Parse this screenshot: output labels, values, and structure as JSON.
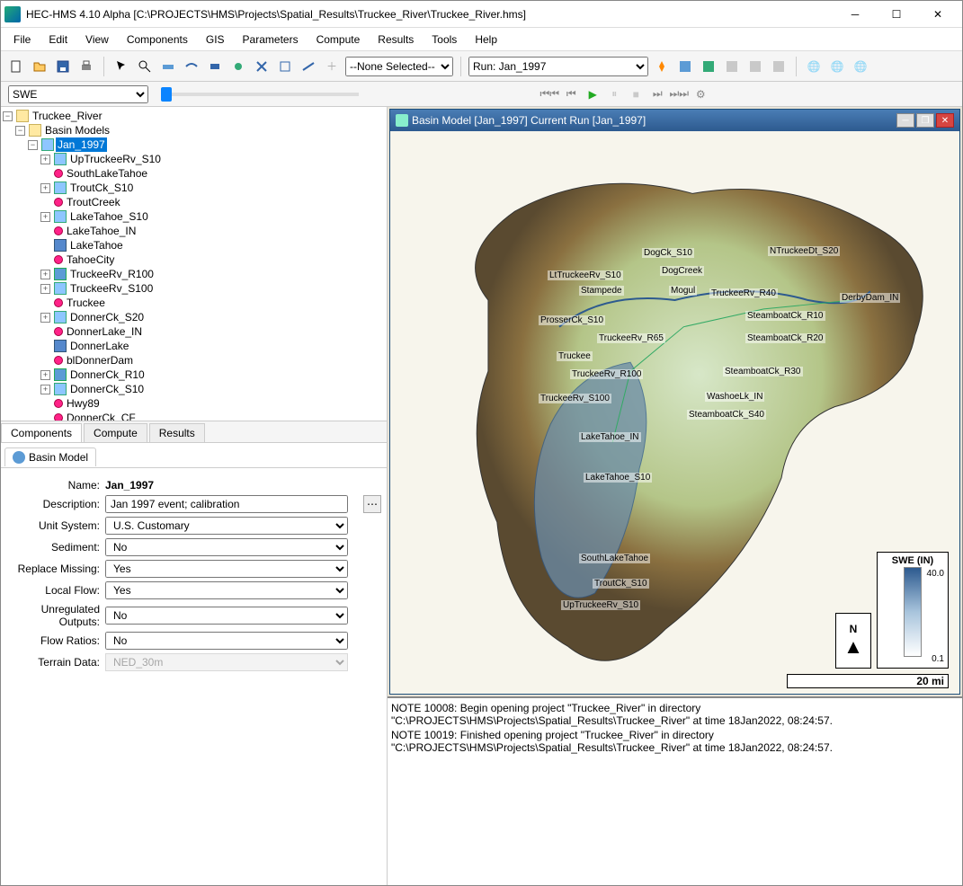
{
  "window": {
    "title": "HEC-HMS 4.10 Alpha [C:\\PROJECTS\\HMS\\Projects\\Spatial_Results\\Truckee_River\\Truckee_River.hms]"
  },
  "menu": [
    "File",
    "Edit",
    "View",
    "Components",
    "GIS",
    "Parameters",
    "Compute",
    "Results",
    "Tools",
    "Help"
  ],
  "toolbar": {
    "none_selected": "--None Selected--",
    "run_label": "Run: Jan_1997"
  },
  "secondbar": {
    "dropdown": "SWE"
  },
  "tree": {
    "root": "Truckee_River",
    "basinmodels": "Basin Models",
    "selected": "Jan_1997",
    "items": [
      "UpTruckeeRv_S10",
      "SouthLakeTahoe",
      "TroutCk_S10",
      "TroutCreek",
      "LakeTahoe_S10",
      "LakeTahoe_IN",
      "LakeTahoe",
      "TahoeCity",
      "TruckeeRv_R100",
      "TruckeeRv_S100",
      "Truckee",
      "DonnerCk_S20",
      "DonnerLake_IN",
      "DonnerLake",
      "blDonnerDam",
      "DonnerCk_R10",
      "DonnerCk_S10",
      "Hwy89",
      "DonnerCk_CF"
    ]
  },
  "tabs": {
    "components": "Components",
    "compute": "Compute",
    "results": "Results"
  },
  "proptab": "Basin Model",
  "props": {
    "name_label": "Name:",
    "name_value": "Jan_1997",
    "desc_label": "Description:",
    "desc_value": "Jan 1997 event; calibration",
    "unit_label": "Unit System:",
    "unit_value": "U.S. Customary",
    "sediment_label": "Sediment:",
    "sediment_value": "No",
    "replace_label": "Replace Missing:",
    "replace_value": "Yes",
    "local_label": "Local Flow:",
    "local_value": "Yes",
    "unreg_label": "Unregulated Outputs:",
    "unreg_value": "No",
    "flow_label": "Flow Ratios:",
    "flow_value": "No",
    "terrain_label": "Terrain Data:",
    "terrain_value": "NED_30m"
  },
  "subwindow": {
    "title": "Basin Model [Jan_1997] Current Run [Jan_1997]"
  },
  "map": {
    "labels": {
      "dogck": "DogCk_S10",
      "dogcreek": "DogCreek",
      "ntruckee": "NTruckeeDt_S20",
      "lttruckee": "LtTruckeeRv_S10",
      "stampede": "Stampede",
      "mogul": "Mogul",
      "truckeerv40": "TruckeeRv_R40",
      "derby": "DerbyDam_IN",
      "prosser": "ProsserCk_S10",
      "truckeerv65": "TruckeeRv_R65",
      "steamr10": "SteamboatCk_R10",
      "steamr20": "SteamboatCk_R20",
      "truckee": "Truckee",
      "truckeerv100": "TruckeeRv_R100",
      "steamr30": "SteamboatCk_R30",
      "truckeervs100": "TruckeeRv_S100",
      "washoe": "WashoeLk_IN",
      "steams40": "SteamboatCk_S40",
      "laketahoein": "LakeTahoe_IN",
      "laketahoes10": "LakeTahoe_S10",
      "southlake": "SouthLakeTahoe",
      "troutck": "TroutCk_S10",
      "uptruckee": "UpTruckeeRv_S10"
    },
    "compass": "N",
    "legend_title": "SWE (IN)",
    "legend_max": "40.0",
    "legend_min": "0.1",
    "scale": "20 mi"
  },
  "log": {
    "line1": "NOTE 10008:  Begin opening project \"Truckee_River\" in directory \"C:\\PROJECTS\\HMS\\Projects\\Spatial_Results\\Truckee_River\" at time 18Jan2022, 08:24:57.",
    "line2": "NOTE 10019:  Finished opening project \"Truckee_River\" in directory \"C:\\PROJECTS\\HMS\\Projects\\Spatial_Results\\Truckee_River\" at time 18Jan2022, 08:24:57."
  }
}
